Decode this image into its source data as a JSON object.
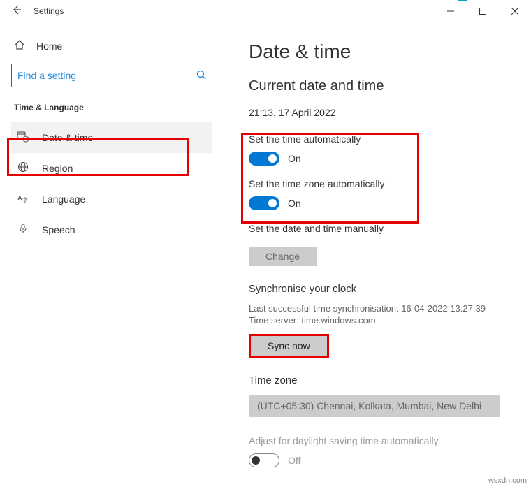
{
  "window": {
    "title": "Settings"
  },
  "sidebar": {
    "home": "Home",
    "search_placeholder": "Find a setting",
    "group": "Time & Language",
    "items": [
      {
        "label": "Date & time"
      },
      {
        "label": "Region"
      },
      {
        "label": "Language"
      },
      {
        "label": "Speech"
      }
    ]
  },
  "content": {
    "heading": "Date & time",
    "subheading": "Current date and time",
    "datetime": "21:13, 17 April 2022",
    "auto_time_label": "Set the time automatically",
    "auto_time_state": "On",
    "auto_tz_label": "Set the time zone automatically",
    "auto_tz_state": "On",
    "manual_label": "Set the date and time manually",
    "change_btn": "Change",
    "sync_heading": "Synchronise your clock",
    "sync_last": "Last successful time synchronisation: 16-04-2022 13:27:39",
    "sync_server": "Time server: time.windows.com",
    "sync_btn": "Sync now",
    "tz_heading": "Time zone",
    "tz_value": "(UTC+05:30) Chennai, Kolkata, Mumbai, New Delhi",
    "dst_label": "Adjust for daylight saving time automatically",
    "dst_state": "Off"
  },
  "watermark": "wsxdn.com"
}
